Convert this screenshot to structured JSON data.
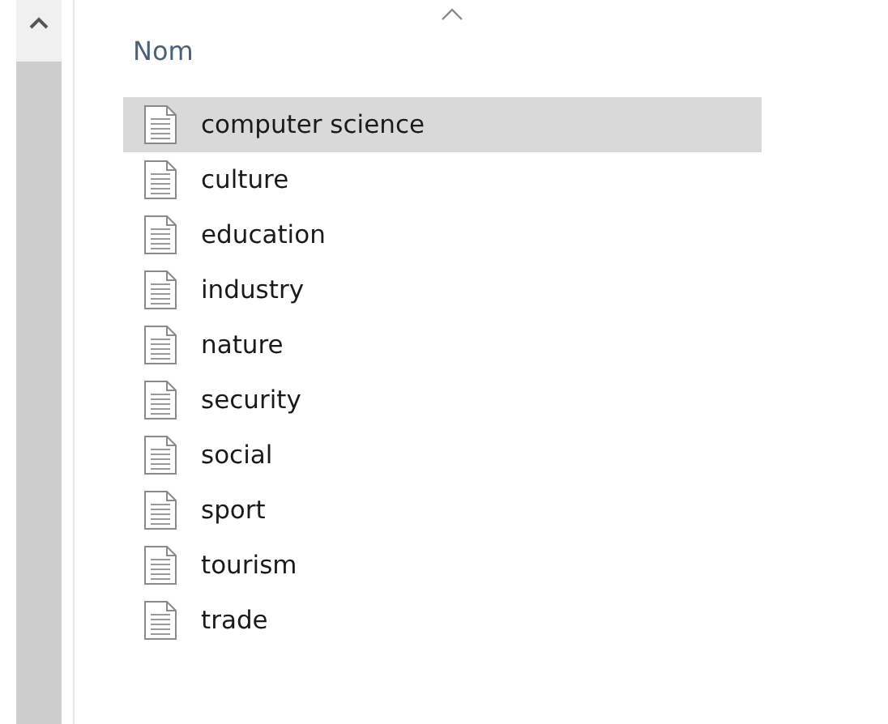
{
  "column_header": {
    "label": "Nom",
    "sort_ascending": true
  },
  "files": [
    {
      "name": "computer science",
      "selected": true
    },
    {
      "name": "culture",
      "selected": false
    },
    {
      "name": "education",
      "selected": false
    },
    {
      "name": "industry",
      "selected": false
    },
    {
      "name": "nature",
      "selected": false
    },
    {
      "name": "security",
      "selected": false
    },
    {
      "name": "social",
      "selected": false
    },
    {
      "name": "sport",
      "selected": false
    },
    {
      "name": "tourism",
      "selected": false
    },
    {
      "name": "trade",
      "selected": false
    }
  ]
}
